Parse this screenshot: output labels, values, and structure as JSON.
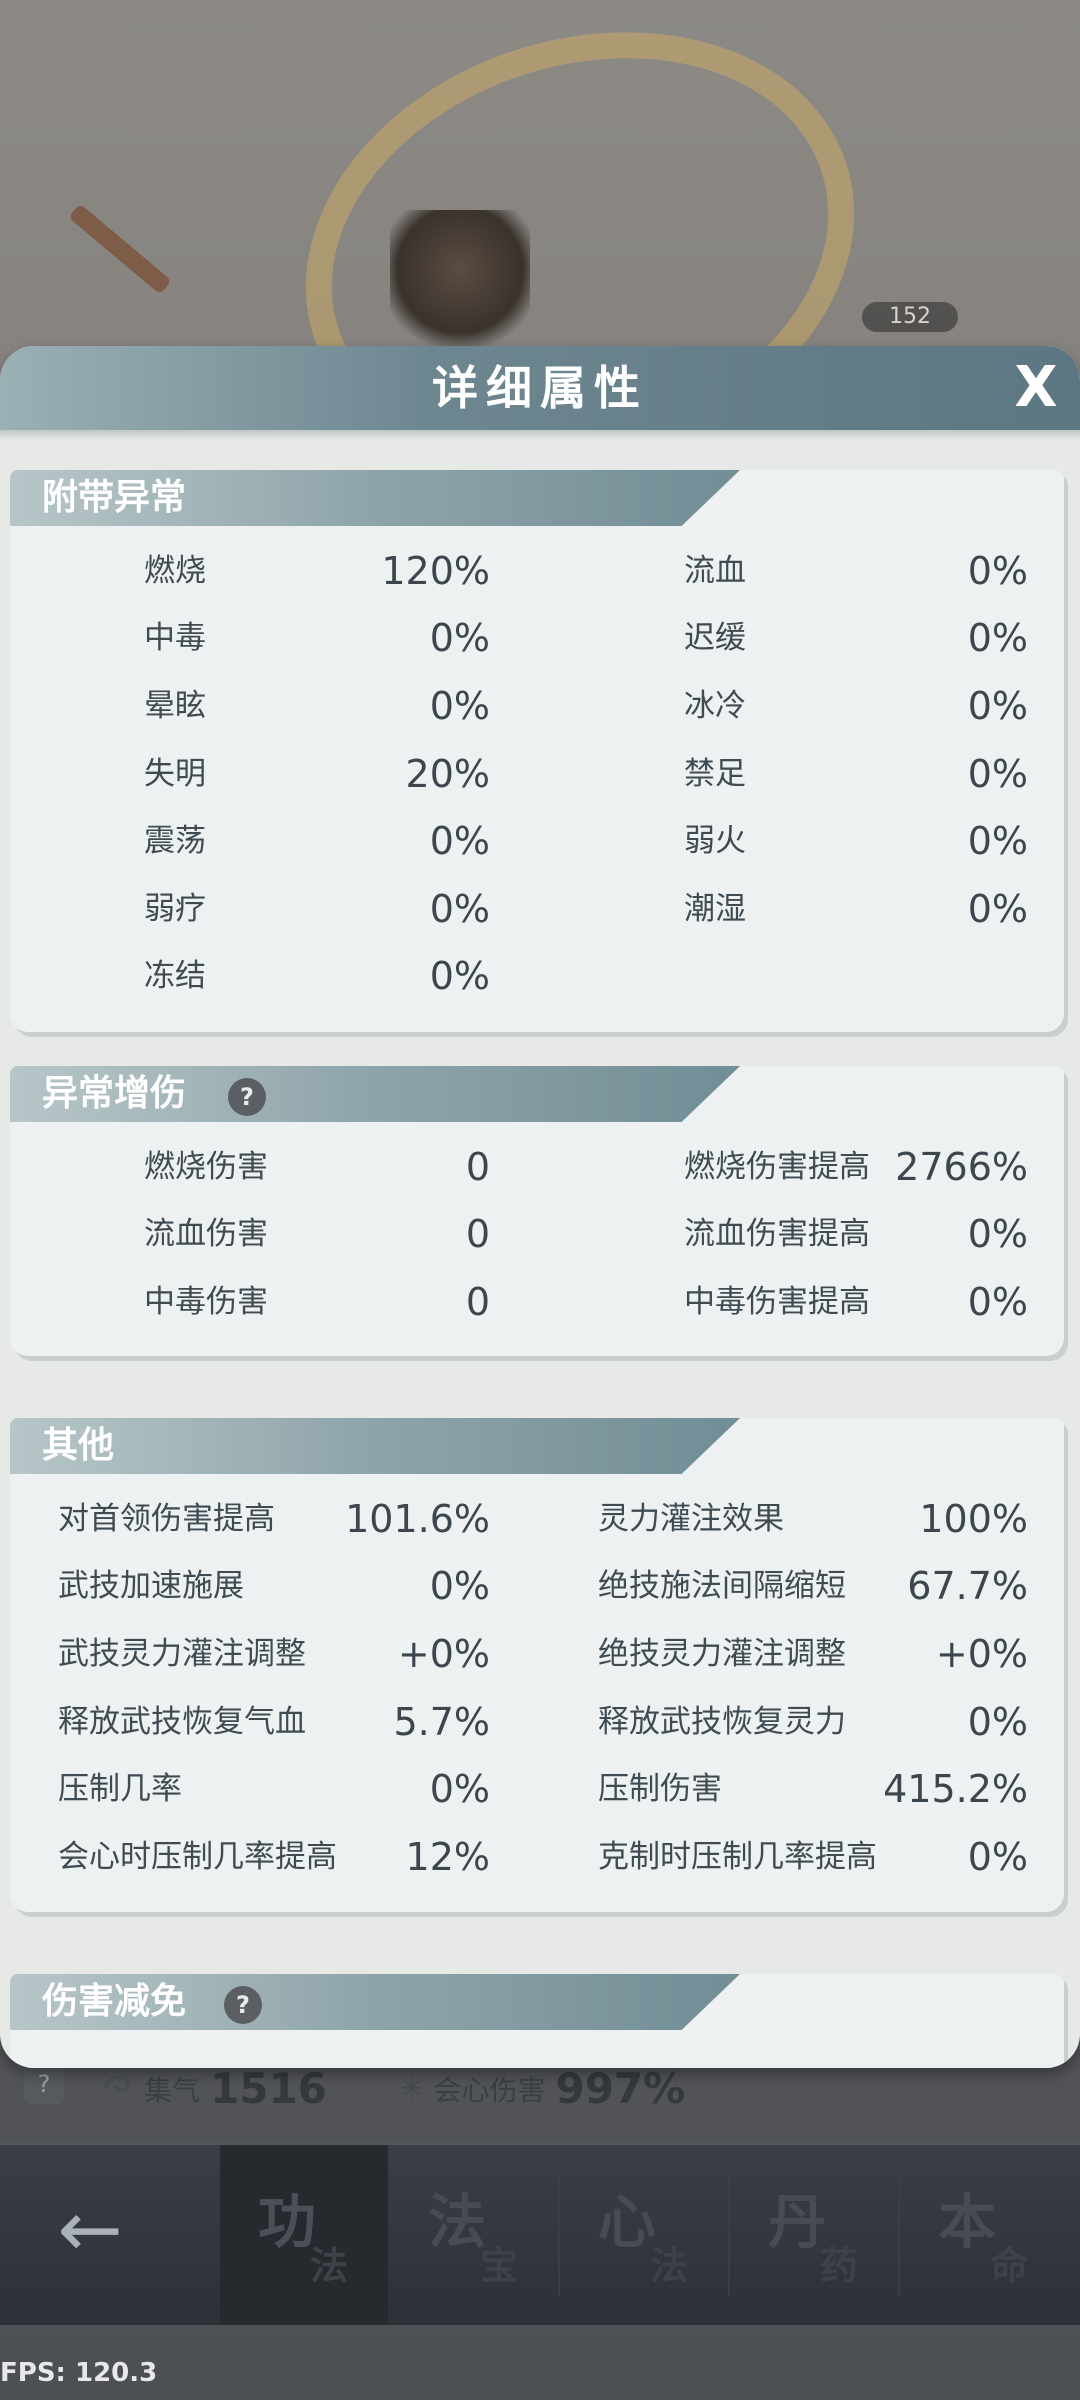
{
  "scene": {
    "level_badge": "152",
    "bottom_strip": {
      "help": "?",
      "stat_left_label": "集气",
      "stat_left_value": "1516",
      "stat_right_label": "会心伤害",
      "stat_right_value": "997%"
    }
  },
  "panel": {
    "title": "详细属性",
    "close": "X",
    "sections": {
      "status": {
        "title": "附带异常",
        "left": [
          {
            "label": "燃烧",
            "value": "120%"
          },
          {
            "label": "中毒",
            "value": "0%"
          },
          {
            "label": "晕眩",
            "value": "0%"
          },
          {
            "label": "失明",
            "value": "20%"
          },
          {
            "label": "震荡",
            "value": "0%"
          },
          {
            "label": "弱疗",
            "value": "0%"
          },
          {
            "label": "冻结",
            "value": "0%"
          }
        ],
        "right": [
          {
            "label": "流血",
            "value": "0%"
          },
          {
            "label": "迟缓",
            "value": "0%"
          },
          {
            "label": "冰冷",
            "value": "0%"
          },
          {
            "label": "禁足",
            "value": "0%"
          },
          {
            "label": "弱火",
            "value": "0%"
          },
          {
            "label": "潮湿",
            "value": "0%"
          }
        ]
      },
      "status_damage": {
        "title": "异常增伤",
        "help": "?",
        "left": [
          {
            "label": "燃烧伤害",
            "value": "0"
          },
          {
            "label": "流血伤害",
            "value": "0"
          },
          {
            "label": "中毒伤害",
            "value": "0"
          }
        ],
        "right": [
          {
            "label": "燃烧伤害提高",
            "value": "2766%"
          },
          {
            "label": "流血伤害提高",
            "value": "0%"
          },
          {
            "label": "中毒伤害提高",
            "value": "0%"
          }
        ]
      },
      "other": {
        "title": "其他",
        "left": [
          {
            "label": "对首领伤害提高",
            "value": "101.6%"
          },
          {
            "label": "武技加速施展",
            "value": "0%"
          },
          {
            "label": "武技灵力灌注调整",
            "value": "+0%"
          },
          {
            "label": "释放武技恢复气血",
            "value": "5.7%"
          },
          {
            "label": "压制几率",
            "value": "0%"
          },
          {
            "label": "会心时压制几率提高",
            "value": "12%"
          }
        ],
        "right": [
          {
            "label": "灵力灌注效果",
            "value": "100%"
          },
          {
            "label": "绝技施法间隔缩短",
            "value": "67.7%"
          },
          {
            "label": "绝技灵力灌注调整",
            "value": "+0%"
          },
          {
            "label": "释放武技恢复灵力",
            "value": "0%"
          },
          {
            "label": "压制伤害",
            "value": "415.2%"
          },
          {
            "label": "克制时压制几率提高",
            "value": "0%"
          }
        ]
      },
      "damage_reduction": {
        "title": "伤害减免",
        "help": "?"
      }
    }
  },
  "nav": {
    "back": "←",
    "tabs": [
      {
        "big": "功",
        "small": "法"
      },
      {
        "big": "法",
        "small": "宝"
      },
      {
        "big": "心",
        "small": "法"
      },
      {
        "big": "丹",
        "small": "药"
      },
      {
        "big": "本",
        "small": "命"
      }
    ]
  },
  "fps": "FPS: 120.3"
}
